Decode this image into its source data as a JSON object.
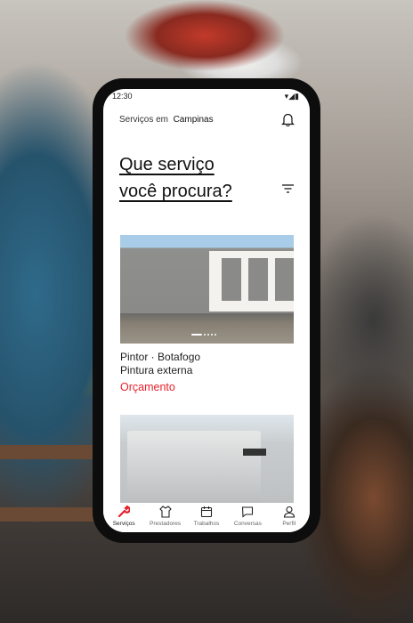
{
  "status_bar": {
    "time": "12:30"
  },
  "header": {
    "location_prefix": "Serviços em",
    "location": "Campinas"
  },
  "title": {
    "line1": "Que serviço",
    "line2": "você procura?"
  },
  "cards": [
    {
      "category": "Pintor · Botafogo",
      "service": "Pintura externa",
      "action": "Orçamento",
      "carousel_active": 1,
      "carousel_count": 5
    }
  ],
  "nav": {
    "items": [
      {
        "label": "Serviços",
        "icon": "wrench-icon",
        "active": true
      },
      {
        "label": "Prestadores",
        "icon": "shirt-icon"
      },
      {
        "label": "Trabalhos",
        "icon": "calendar-icon"
      },
      {
        "label": "Conversas",
        "icon": "chat-icon"
      },
      {
        "label": "Perfil",
        "icon": "user-icon"
      }
    ]
  },
  "colors": {
    "accent": "#e8202a",
    "phone_frame": "#0d0d0d"
  }
}
